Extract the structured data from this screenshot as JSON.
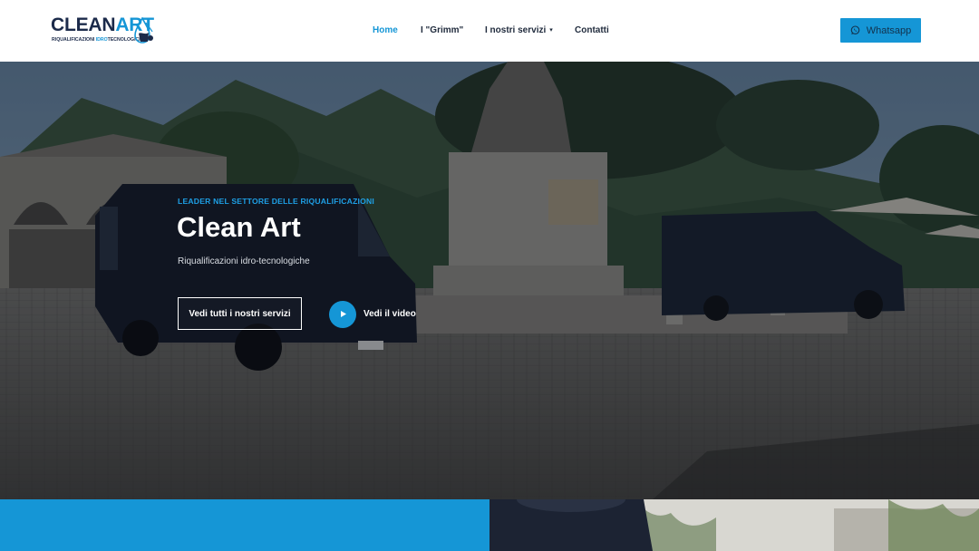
{
  "brand": {
    "logo_text_a": "CLEAN",
    "logo_text_b": "ART",
    "logo_tagline_a": "RIQUALIFICAZIONI ",
    "logo_tagline_b": "IDRO",
    "logo_tagline_c": "TECNOLOGICHE",
    "accent_color": "#1596d6",
    "dark_color": "#1b2a4a"
  },
  "nav": {
    "items": [
      {
        "label": "Home",
        "active": true
      },
      {
        "label": "I \"Grimm\"",
        "active": false
      },
      {
        "label": "I nostri servizi",
        "active": false,
        "has_dropdown": true,
        "caret": "▾"
      },
      {
        "label": "Contatti",
        "active": false
      }
    ]
  },
  "header": {
    "whatsapp_label": "Whatsapp",
    "whatsapp_icon": "whatsapp-icon"
  },
  "hero": {
    "eyebrow": "LEADER NEL SETTORE DELLE RIQUALIFICAZIONI",
    "title": "Clean Art",
    "subtitle": "Riqualificazioni idro-tecnologiche",
    "cta_label": "Vedi tutti i nostri servizi",
    "video_label": "Vedi il video",
    "video_icon": "play-icon"
  }
}
